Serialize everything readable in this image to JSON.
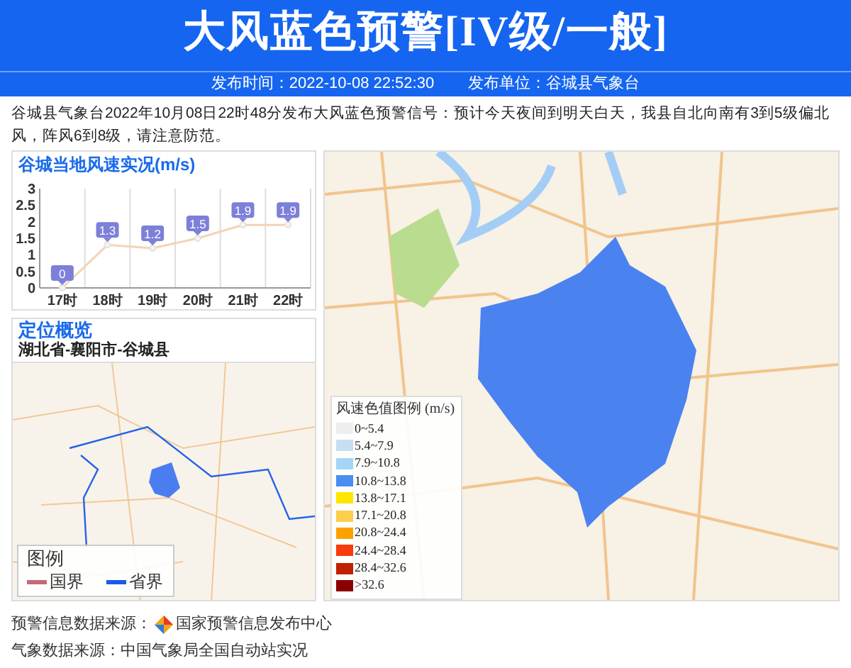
{
  "header": {
    "title": "大风蓝色预警[IV级/一般]",
    "publish_time": "发布时间：2022-10-08 22:52:30",
    "publisher": "发布单位：谷城县气象台"
  },
  "description": "谷城县气象台2022年10月08日22时48分发布大风蓝色预警信号：预计今天夜间到明天白天，我县自北向南有3到5级偏北风，阵风6到8级，请注意防范。",
  "wind_chart": {
    "title": "谷城当地风速实况(m/s)",
    "chart_data": {
      "type": "line",
      "categories": [
        "17时",
        "18时",
        "19时",
        "20时",
        "21时",
        "22时"
      ],
      "series": [
        {
          "color": "#f3d3b8",
          "marker": true,
          "values": [
            0,
            1.3,
            1.2,
            1.5,
            1.9,
            1.9
          ]
        }
      ],
      "ylim": [
        0,
        3
      ],
      "yticks": [
        0,
        0.5,
        1,
        1.5,
        2,
        2.5,
        3
      ],
      "data_labels": true
    }
  },
  "location": {
    "title": "定位概览",
    "region": "湖北省-襄阳市-谷城县",
    "legend": {
      "title": "图例",
      "items": [
        {
          "label": "国界",
          "color": "#c46a78"
        },
        {
          "label": "省界",
          "color": "#1a5ae8"
        }
      ]
    }
  },
  "wind_legend": {
    "title": "风速色值图例 (m/s)",
    "items": [
      {
        "label": "0~5.4",
        "color": "#eeeeee"
      },
      {
        "label": "5.4~7.9",
        "color": "#c6def2"
      },
      {
        "label": "7.9~10.8",
        "color": "#a4d4f6"
      },
      {
        "label": "10.8~13.8",
        "color": "#4a8ef0"
      },
      {
        "label": "13.8~17.1",
        "color": "#fee600"
      },
      {
        "label": "17.1~20.8",
        "color": "#fccf4a"
      },
      {
        "label": "20.8~24.4",
        "color": "#fda100"
      },
      {
        "label": "24.4~28.4",
        "color": "#f73c10"
      },
      {
        "label": "28.4~32.6",
        "color": "#c01f00"
      },
      {
        "label": ">32.6",
        "color": "#8c0000"
      }
    ]
  },
  "footer": {
    "warning_source_label": "预警信息数据来源：",
    "warning_source": "国家预警信息发布中心",
    "weather_source": "气象数据来源：中国气象局全国自动站实况"
  }
}
